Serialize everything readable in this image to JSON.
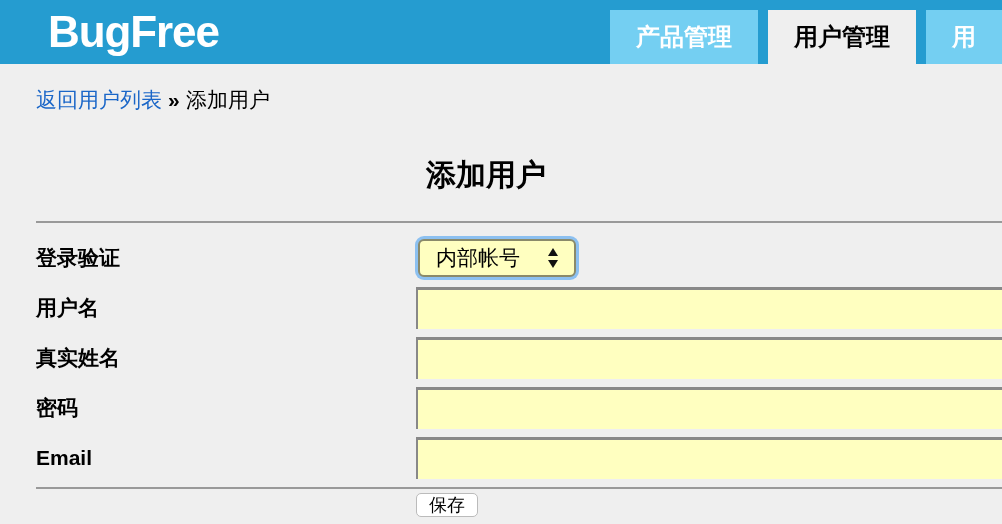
{
  "header": {
    "logo": "BugFree",
    "tabs": [
      {
        "label": "产品管理",
        "selected": false
      },
      {
        "label": "用户管理",
        "selected": true
      },
      {
        "label": "用",
        "selected": false
      }
    ]
  },
  "breadcrumb": {
    "link": "返回用户列表",
    "separator": "»",
    "current": "添加用户"
  },
  "form": {
    "title": "添加用户",
    "fields": [
      {
        "kind": "select",
        "label": "登录验证",
        "value": "内部帐号"
      },
      {
        "kind": "text",
        "label": "用户名"
      },
      {
        "kind": "text",
        "label": "真实姓名"
      },
      {
        "kind": "password",
        "label": "密码"
      },
      {
        "kind": "text",
        "label": "Email"
      }
    ],
    "submit": "保存"
  }
}
